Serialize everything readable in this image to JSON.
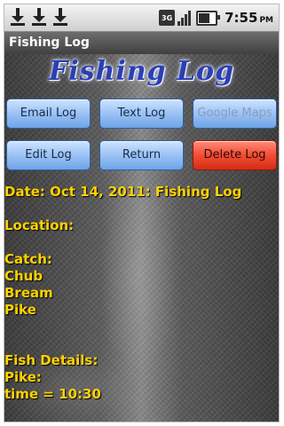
{
  "status_bar": {
    "time": "7:55",
    "ampm": "PM",
    "network": "3G"
  },
  "app": {
    "title": "Fishing Log",
    "logo": "Fishing Log"
  },
  "buttons": {
    "email_log": "Email Log",
    "text_log": "Text Log",
    "google_maps": "Google Maps",
    "edit_log": "Edit Log",
    "return": "Return",
    "delete_log": "Delete Log"
  },
  "log": {
    "date_line": "Date: Oct 14, 2011: Fishing Log",
    "location_label": "Location:",
    "catch_label": "Catch:",
    "catch_items": [
      "Chub",
      "Bream",
      "Pike"
    ],
    "details_label": "Fish Details:",
    "detail_fish": "Pike:",
    "detail_time": "time = 10:30"
  },
  "colors": {
    "log_text": "#ffd200",
    "button_blue": "#9fc5f5",
    "button_red": "#f24d33",
    "logo_blue": "#2a3fb5"
  },
  "icons": {
    "notifications": [
      "download-icon",
      "download-icon",
      "download-icon"
    ],
    "status": [
      "3g-icon",
      "signal-icon",
      "battery-icon"
    ]
  }
}
